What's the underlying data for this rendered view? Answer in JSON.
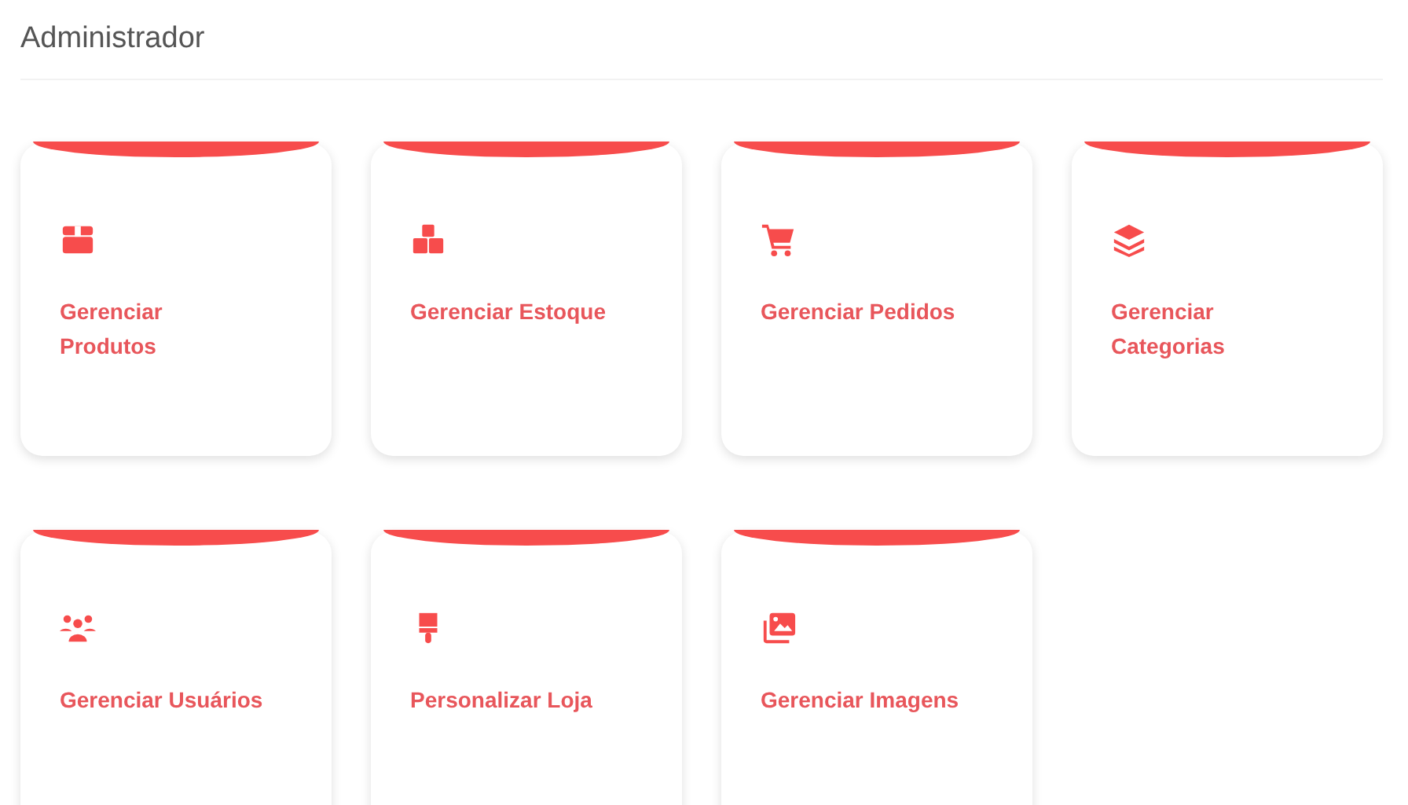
{
  "page_title": "Administrador",
  "cards": [
    {
      "kind": "box",
      "label": "Gerenciar Produtos"
    },
    {
      "kind": "boxes",
      "label": "Gerenciar Estoque"
    },
    {
      "kind": "cart",
      "label": "Gerenciar Pedidos"
    },
    {
      "kind": "layers",
      "label": "Gerenciar Categorias"
    },
    {
      "kind": "users",
      "label": "Gerenciar Usuários"
    },
    {
      "kind": "brush",
      "label": "Personalizar Loja"
    },
    {
      "kind": "images",
      "label": "Gerenciar Imagens"
    }
  ]
}
